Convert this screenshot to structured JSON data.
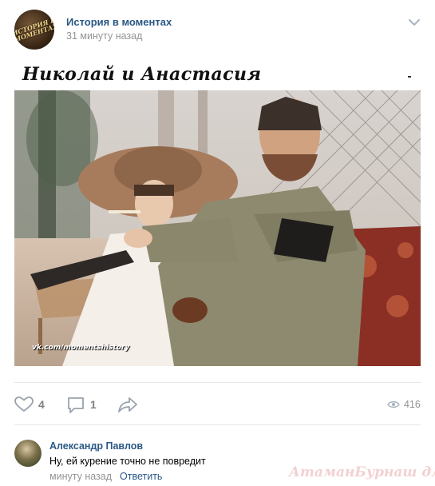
{
  "post": {
    "group_name": "История в моментах",
    "time": "31 минуту назад",
    "avatar_text": "ИСТОРИЯ В МОМЕНТАХ",
    "image_title": "Николай и Анастасия",
    "image_watermark": "vk.com/momentshistory"
  },
  "actions": {
    "likes": "4",
    "comments": "1",
    "views": "416"
  },
  "comment": {
    "author": "Александр Павлов",
    "text": "Ну, ей курение точно не повредит",
    "time": "минуту назад",
    "reply_label": "Ответить"
  },
  "site_watermark": "АтаманБурнаш для ЯП",
  "colors": {
    "link": "#2a5885",
    "muted": "#939393",
    "divider": "#e7e8ec",
    "icon": "#99a2ad"
  },
  "icons": {
    "menu": "chevron-down-icon",
    "like": "heart-icon",
    "comment": "comment-icon",
    "share": "share-arrow-icon",
    "views": "eye-icon"
  }
}
